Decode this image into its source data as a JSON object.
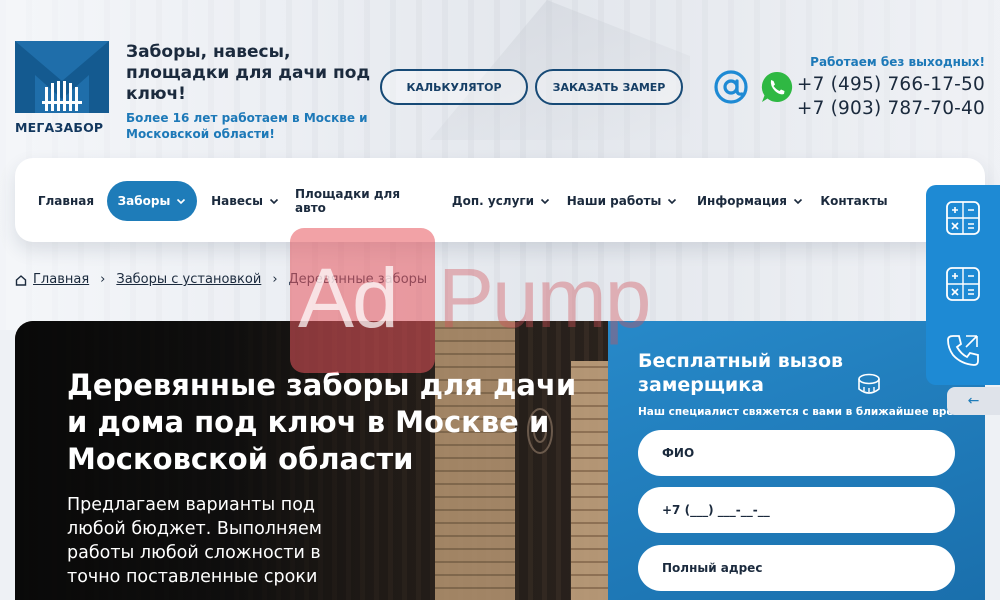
{
  "brand": {
    "logo_text": "МЕГАЗАБОР",
    "tagline_title": "Заборы, навесы, площадки для дачи под ключ!",
    "tagline_sub": "Более 16 лет работаем в Москве и Московской области!"
  },
  "header": {
    "calculator_button": "КАЛЬКУЛЯТОР",
    "measure_button": "ЗАКАЗАТЬ ЗАМЕР",
    "icons": [
      "email-icon",
      "whatsapp-icon"
    ],
    "work_note": "Работаем без выходных!",
    "phones": [
      "+7 (495) 766-17-50",
      "+7 (903) 787-70-40"
    ]
  },
  "nav": {
    "items": [
      {
        "label": "Главная",
        "dropdown": false,
        "active": false
      },
      {
        "label": "Заборы",
        "dropdown": true,
        "active": true
      },
      {
        "label": "Навесы",
        "dropdown": true,
        "active": false
      },
      {
        "label": "Площадки для авто",
        "dropdown": false,
        "active": false
      },
      {
        "label": "Доп. услуги",
        "dropdown": true,
        "active": false
      },
      {
        "label": "Наши работы",
        "dropdown": true,
        "active": false
      },
      {
        "label": "Информация",
        "dropdown": true,
        "active": false
      },
      {
        "label": "Контакты",
        "dropdown": false,
        "active": false
      }
    ]
  },
  "side_panel": {
    "icons": [
      "calculator-icon",
      "calculator-icon",
      "phone-call-icon"
    ],
    "collapse_glyph": "←"
  },
  "breadcrumb": {
    "items": [
      "Главная",
      "Заборы с установкой"
    ],
    "current": "Деревянные заборы",
    "separator": "›"
  },
  "hero": {
    "title": "Деревянные заборы для дачи и дома под ключ в Москве и Московской области",
    "subtitle": "Предлагаем варианты под любой бюджет. Выполняем работы любой сложности в точно поставленные сроки"
  },
  "form": {
    "title": "Бесплатный вызов замерщика",
    "note": "Наш специалист свяжется с вами в ближайшее время",
    "fields": [
      {
        "placeholder": "ФИО",
        "value": ""
      },
      {
        "placeholder": "+7 (___) ___-__-__",
        "value": ""
      },
      {
        "placeholder": "Полный адрес",
        "value": ""
      }
    ]
  },
  "watermark": {
    "part1": "Ad",
    "part2": "Pump"
  },
  "colors": {
    "accent": "#1e7cb9",
    "dark_text": "#1b2a3d",
    "link_blue": "#1d79b8",
    "side_panel": "#1e8ad4",
    "whatsapp": "#2fb843"
  }
}
